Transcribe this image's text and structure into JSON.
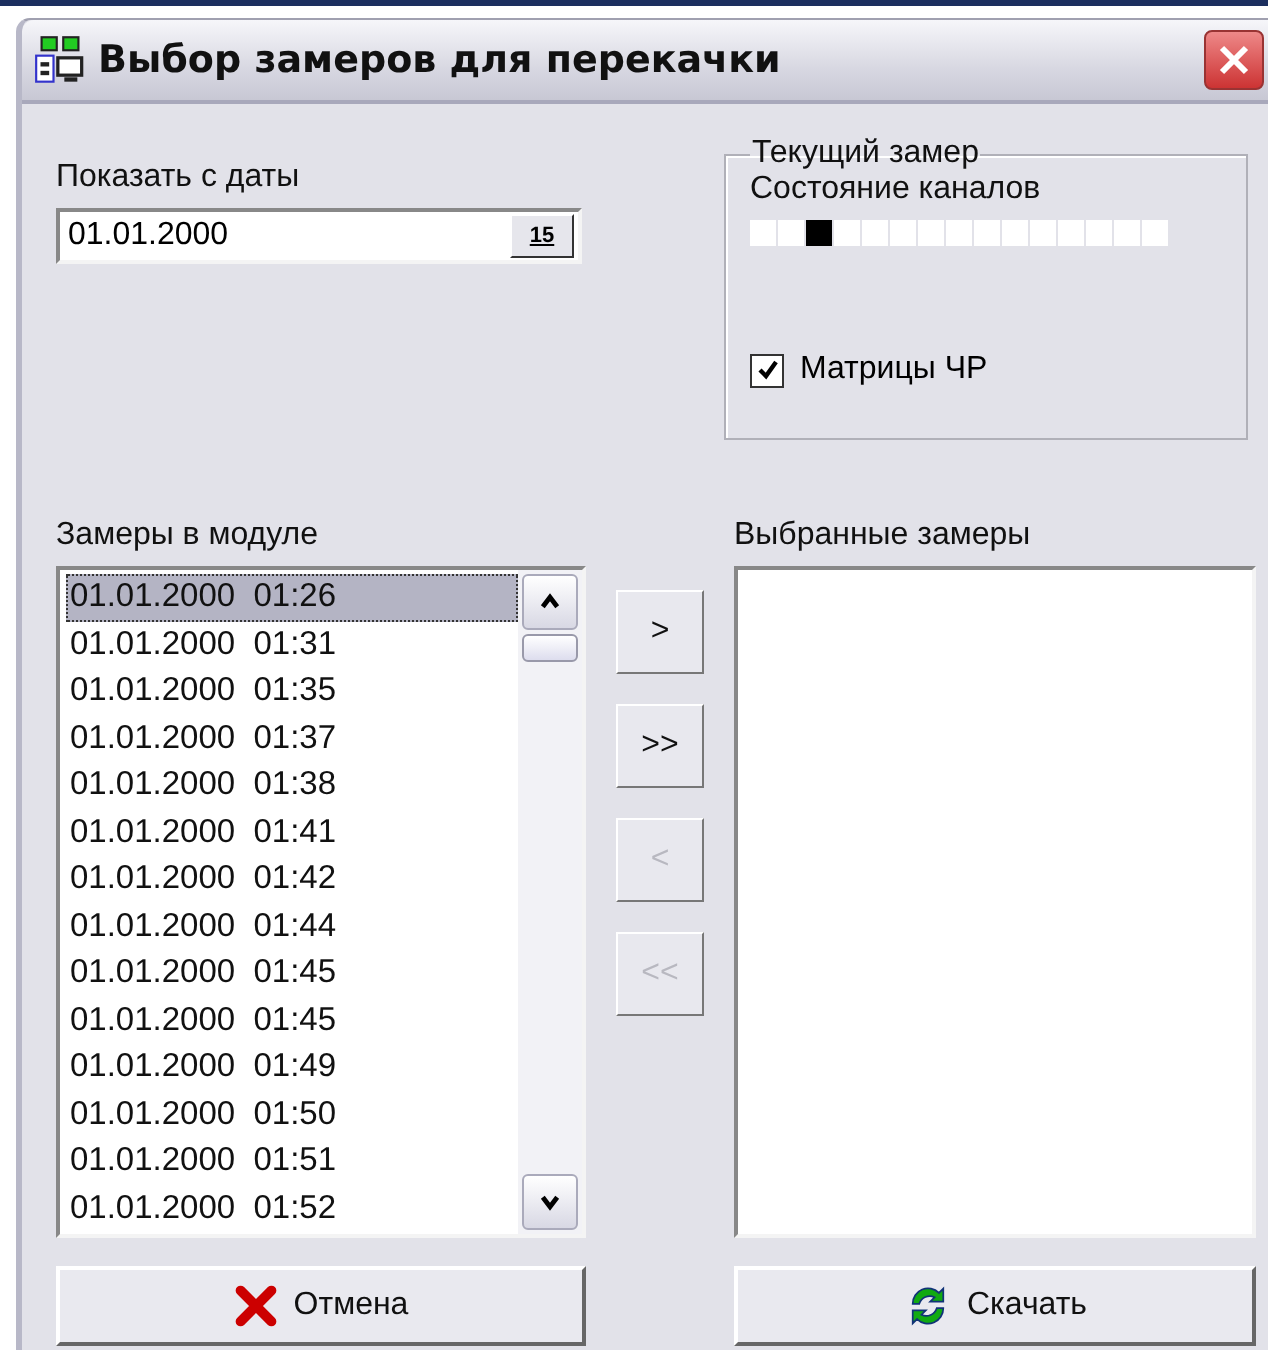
{
  "window": {
    "title": "Выбор замеров для перекачки"
  },
  "date_filter": {
    "label": "Показать с даты",
    "value": "01.01.2000",
    "calendar_button": "15"
  },
  "current_measurement": {
    "title": "Текущий замер",
    "channels_label": "Состояние каналов",
    "channels": [
      {
        "active": false
      },
      {
        "active": false
      },
      {
        "active": true
      },
      {
        "active": false
      },
      {
        "active": false
      },
      {
        "active": false
      },
      {
        "active": false
      },
      {
        "active": false
      },
      {
        "active": false
      },
      {
        "active": false
      },
      {
        "active": false
      },
      {
        "active": false
      },
      {
        "active": false
      },
      {
        "active": false
      },
      {
        "active": false
      }
    ],
    "fr_matrices": {
      "label": "Матрицы ЧР",
      "checked": true
    }
  },
  "module_list": {
    "label": "Замеры в модуле",
    "items": [
      {
        "text": "01.01.2000  01:26",
        "selected": true
      },
      {
        "text": "01.01.2000  01:31",
        "selected": false
      },
      {
        "text": "01.01.2000  01:35",
        "selected": false
      },
      {
        "text": "01.01.2000  01:37",
        "selected": false
      },
      {
        "text": "01.01.2000  01:38",
        "selected": false
      },
      {
        "text": "01.01.2000  01:41",
        "selected": false
      },
      {
        "text": "01.01.2000  01:42",
        "selected": false
      },
      {
        "text": "01.01.2000  01:44",
        "selected": false
      },
      {
        "text": "01.01.2000  01:45",
        "selected": false
      },
      {
        "text": "01.01.2000  01:45",
        "selected": false
      },
      {
        "text": "01.01.2000  01:49",
        "selected": false
      },
      {
        "text": "01.01.2000  01:50",
        "selected": false
      },
      {
        "text": "01.01.2000  01:51",
        "selected": false
      },
      {
        "text": "01.01.2000  01:52",
        "selected": false
      }
    ]
  },
  "transfer_buttons": [
    {
      "label": ">",
      "disabled": false
    },
    {
      "label": ">>",
      "disabled": false
    },
    {
      "label": "<",
      "disabled": true
    },
    {
      "label": "<<",
      "disabled": true
    }
  ],
  "selected_list": {
    "label": "Выбранные замеры"
  },
  "buttons": [
    {
      "kind": "cancel",
      "label": "Отмена"
    },
    {
      "kind": "download",
      "label": "Скачать"
    }
  ]
}
